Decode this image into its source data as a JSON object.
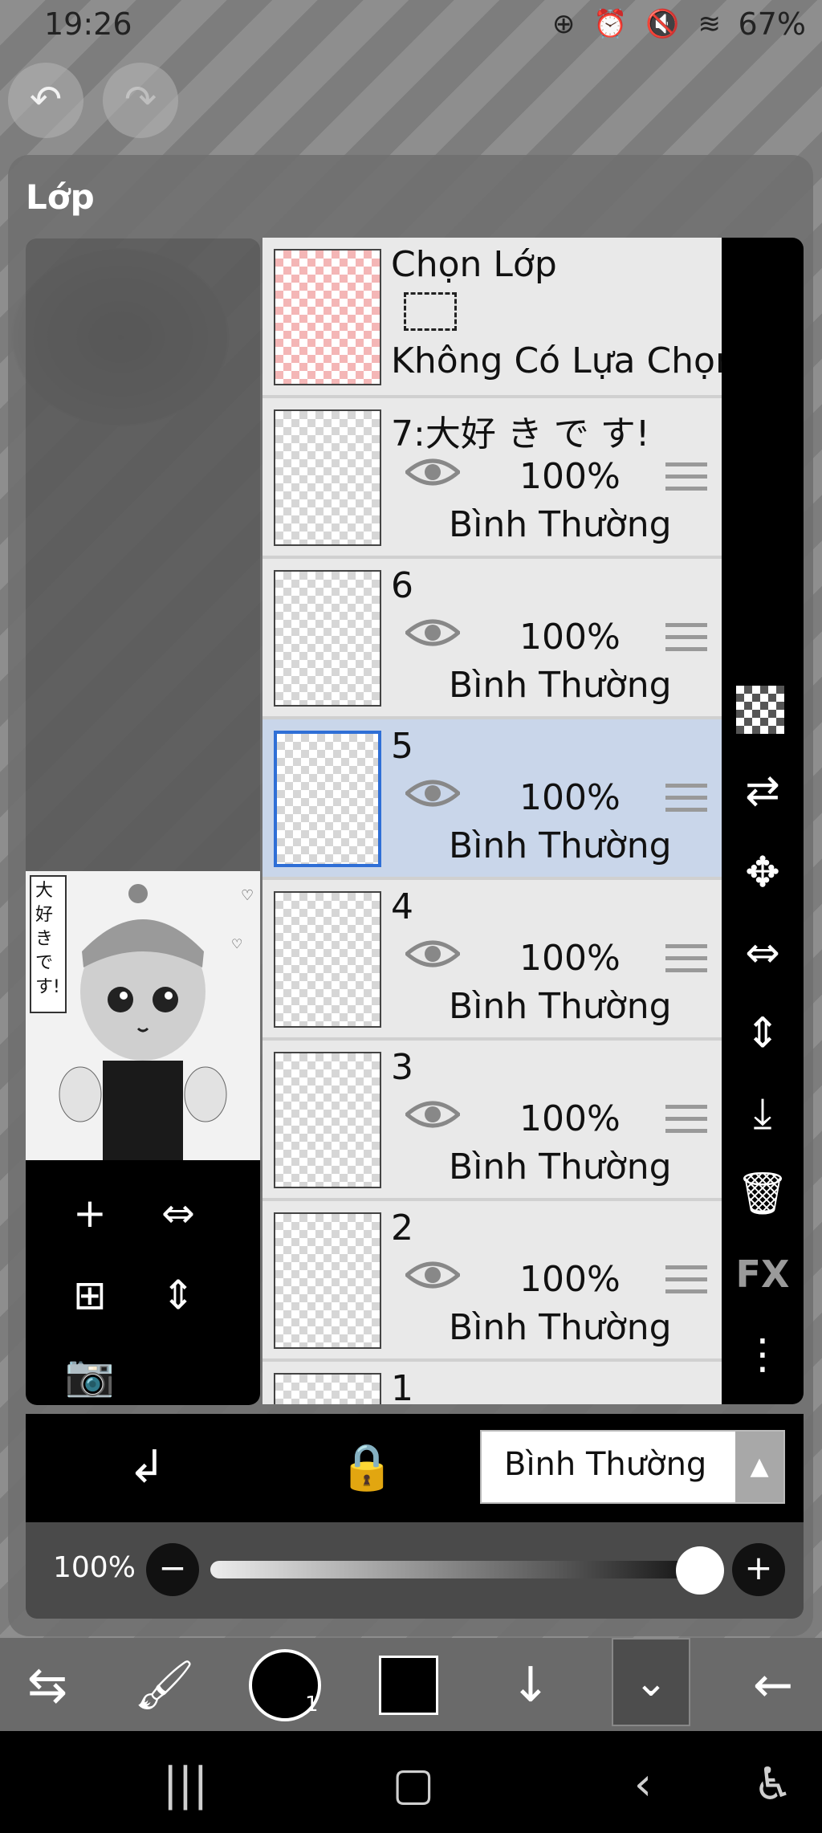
{
  "status_bar": {
    "time": "19:26",
    "icons": "⊕ ⏰ 🔇 ≋",
    "battery": "67%"
  },
  "top_buttons": {
    "undo_icon": "undo-icon",
    "redo_icon": "redo-icon"
  },
  "panel": {
    "title": "Lớp"
  },
  "selection_layer": {
    "title": "Chọn Lớp",
    "subtitle": "Không Có Lựa Chọn"
  },
  "layers": [
    {
      "name": "7:大好 き で す!",
      "opacity": "100%",
      "blend": "Bình Thường"
    },
    {
      "name": "6",
      "opacity": "100%",
      "blend": "Bình Thường"
    },
    {
      "name": "5",
      "opacity": "100%",
      "blend": "Bình Thường"
    },
    {
      "name": "4",
      "opacity": "100%",
      "blend": "Bình Thường"
    },
    {
      "name": "3",
      "opacity": "100%",
      "blend": "Bình Thường"
    },
    {
      "name": "2",
      "opacity": "100%",
      "blend": "Bình Thường"
    },
    {
      "name": "1"
    }
  ],
  "preview": {
    "caption": "大好きです!"
  },
  "blend_mode": {
    "selected": "Bình Thường"
  },
  "opacity_slider": {
    "label": "100%",
    "value": 1.0,
    "minus": "−",
    "plus": "+"
  },
  "toolbar": {
    "brush_size": "1"
  },
  "right_toolbar": {
    "fx_label": "FX"
  },
  "colors": {
    "selected_layer": "#c9d6ea",
    "selection_border": "#2f6fd6"
  }
}
